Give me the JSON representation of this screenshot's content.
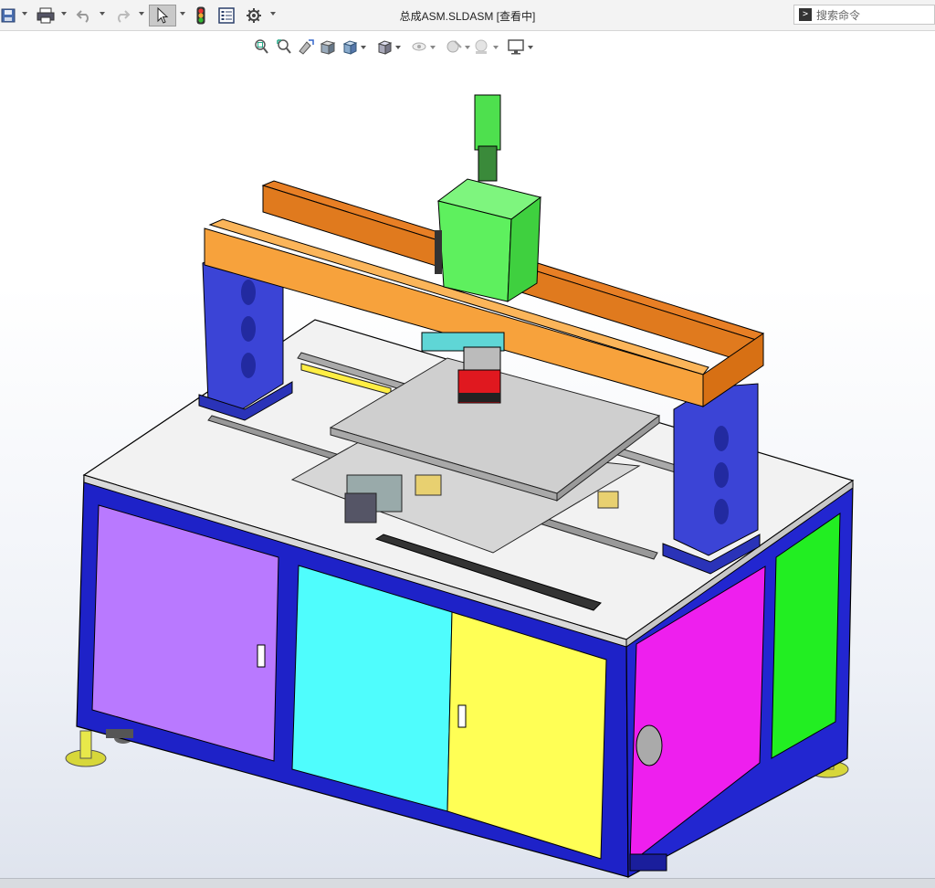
{
  "window": {
    "title": "总成ASM.SLDASM [查看中]"
  },
  "toolbar": {
    "items": [
      "save-icon",
      "print-icon",
      "undo-icon",
      "redo-icon",
      "select-icon",
      "rebuild-icon",
      "file-properties-icon",
      "options-icon"
    ]
  },
  "search": {
    "placeholder": "搜索命令"
  },
  "heads_up_toolbar": {
    "items": [
      "zoom-to-fit-icon",
      "zoom-to-area-icon",
      "previous-view-icon",
      "section-view-icon",
      "view-orientation-icon",
      "display-style-icon",
      "hide-show-items-icon",
      "edit-appearance-icon",
      "apply-scene-icon",
      "view-settings-icon"
    ]
  },
  "colors": {
    "cabinet_frame": "#1e22c8",
    "door_purple": "#b979ff",
    "door_cyan": "#4ffdfd",
    "door_yellow": "#ffff55",
    "door_magenta": "#ee1fee",
    "door_green": "#22ee22",
    "gantry_orange": "#f7a23c",
    "gantry_support": "#3b44d6",
    "cylinder_green": "#5ef05e",
    "motor_red": "#e0181f",
    "feet_yellow": "#e8e84a"
  }
}
